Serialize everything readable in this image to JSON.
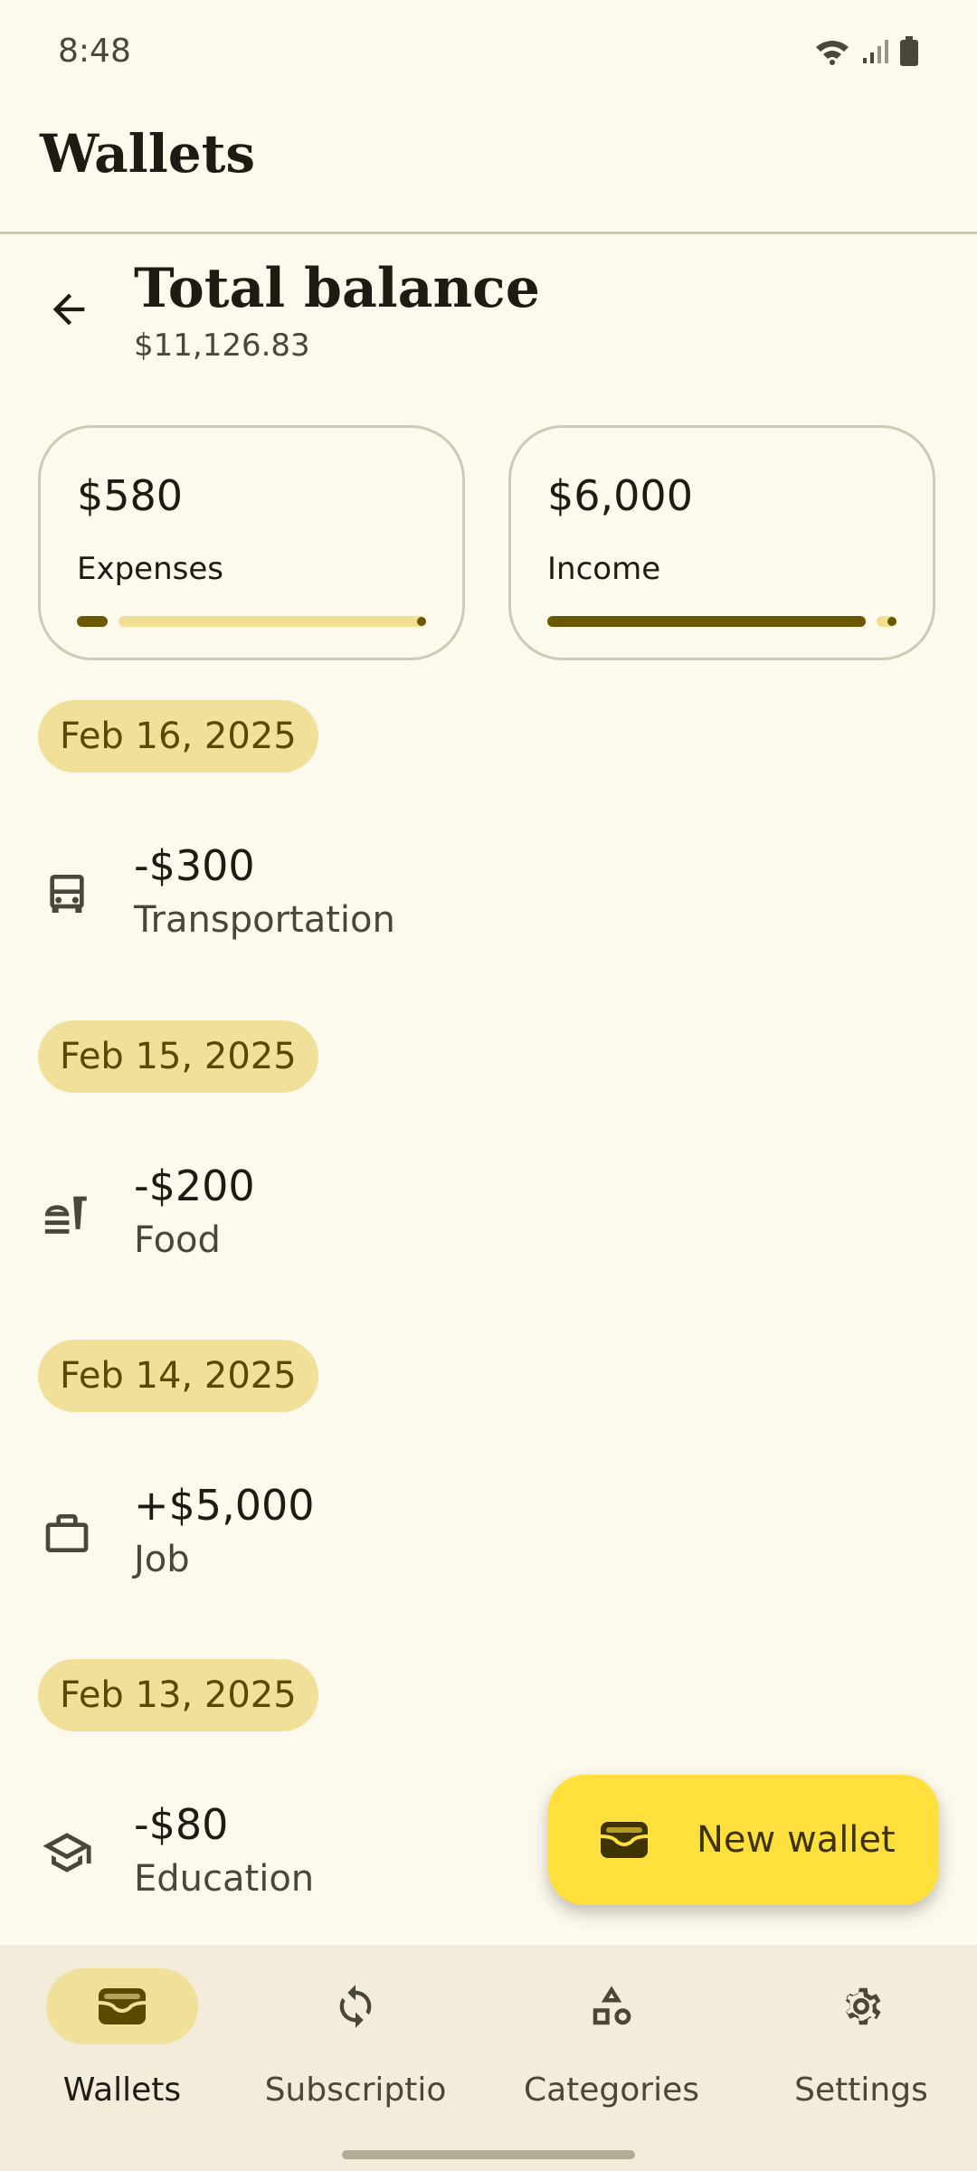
{
  "status_bar": {
    "time": "8:48"
  },
  "top_bar": {
    "title": "Wallets"
  },
  "header": {
    "title": "Total balance",
    "balance": "$11,126.83"
  },
  "summary": {
    "expenses": {
      "amount": "$580",
      "label": "Expenses",
      "progress": 0.088
    },
    "income": {
      "amount": "$6,000",
      "label": "Income",
      "progress": 0.912
    }
  },
  "groups": [
    {
      "date": "Feb 16, 2025",
      "items": [
        {
          "amount": "-$300",
          "category": "Transportation",
          "icon": "bus-icon"
        }
      ]
    },
    {
      "date": "Feb 15, 2025",
      "items": [
        {
          "amount": "-$200",
          "category": "Food",
          "icon": "fastfood-icon"
        }
      ]
    },
    {
      "date": "Feb 14, 2025",
      "items": [
        {
          "amount": "+$5,000",
          "category": "Job",
          "icon": "briefcase-icon"
        }
      ]
    },
    {
      "date": "Feb 13, 2025",
      "items": [
        {
          "amount": "-$80",
          "category": "Education",
          "icon": "graduation-cap-icon"
        }
      ]
    }
  ],
  "fab": {
    "label": "New wallet",
    "icon": "wallet-icon"
  },
  "nav": [
    {
      "label": "Wallets",
      "icon": "wallet-icon",
      "active": true
    },
    {
      "label": "Subscriptio",
      "icon": "refresh-icon",
      "active": false
    },
    {
      "label": "Categories",
      "icon": "shapes-icon",
      "active": false
    },
    {
      "label": "Settings",
      "icon": "gear-icon",
      "active": false
    }
  ],
  "colors": {
    "background": "#fdf9ec",
    "primary": "#6b5800",
    "chip": "#f1e09a",
    "fab": "#ffe03d",
    "nav_background": "#f4ecda"
  }
}
